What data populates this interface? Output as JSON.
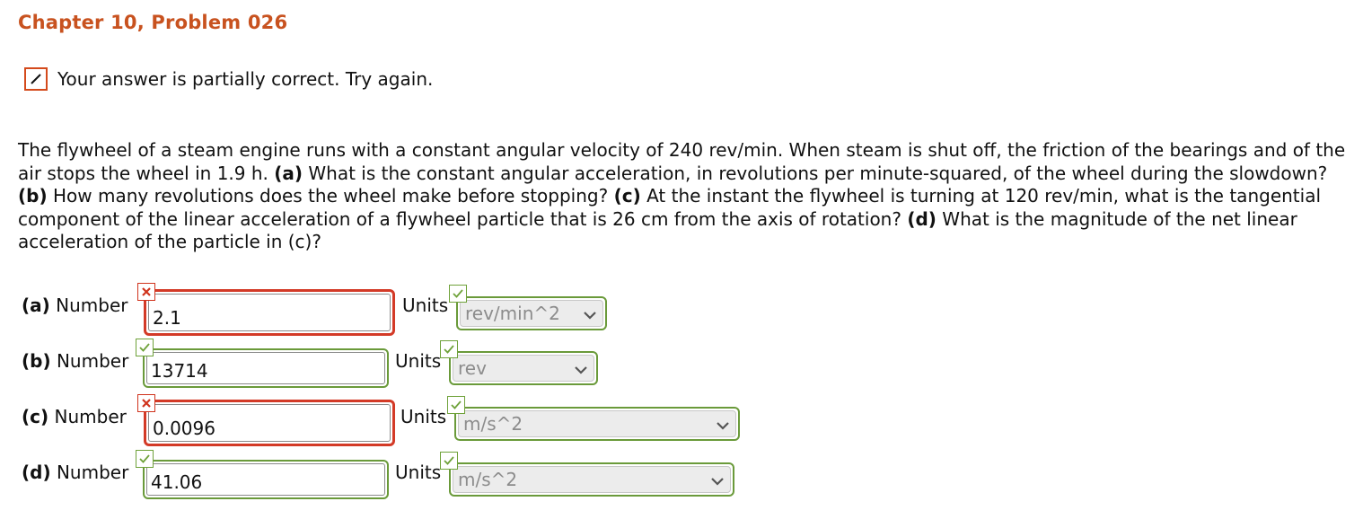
{
  "header": {
    "title": "Chapter 10, Problem 026"
  },
  "status": {
    "message": "Your answer is partially correct.  Try again.",
    "icon": "pencil-icon"
  },
  "problem": {
    "p1": "The flywheel of a steam engine runs with a constant angular velocity of 240 rev/min. When steam is shut off, the friction of the bearings and of the air stops the wheel in 1.9 h. ",
    "a_tag": "(a)",
    "p2": " What is the constant angular acceleration, in revolutions per minute-squared, of the wheel during the slowdown? ",
    "b_tag": "(b)",
    "p3": " How many revolutions does the wheel make before stopping? ",
    "c_tag": "(c)",
    "p4": " At the instant the flywheel is turning at 120 rev/min, what is the tangential component of the linear acceleration of a flywheel particle that is 26 cm from the axis of rotation? ",
    "d_tag": "(d)",
    "p5": " What is the magnitude of the net linear acceleration of the particle in (c)?"
  },
  "answers": [
    {
      "tag": "(a)",
      "label": " Number",
      "value": "2.1",
      "number_status": "incorrect",
      "units_label": "Units",
      "unit": "rev/min^2",
      "unit_status": "correct"
    },
    {
      "tag": "(b)",
      "label": " Number",
      "value": "13714",
      "number_status": "correct",
      "units_label": "Units",
      "unit": "rev",
      "unit_status": "correct"
    },
    {
      "tag": "(c)",
      "label": " Number",
      "value": "0.0096",
      "number_status": "incorrect",
      "units_label": "Units",
      "unit": "m/s^2",
      "unit_status": "correct"
    },
    {
      "tag": "(d)",
      "label": " Number",
      "value": "41.06",
      "number_status": "correct",
      "units_label": "Units",
      "unit": "m/s^2",
      "unit_status": "correct"
    }
  ],
  "colors": {
    "title": "#c8521f",
    "correct": "#6a9a3a",
    "incorrect": "#d33a27"
  }
}
